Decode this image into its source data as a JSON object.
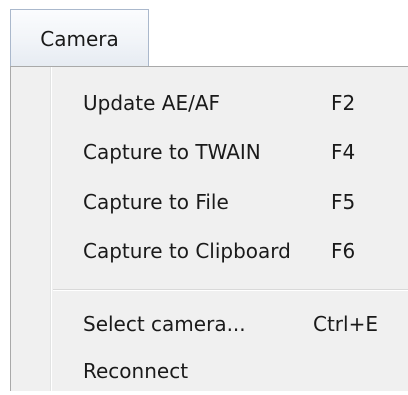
{
  "menubar": {
    "camera_label": "Camera"
  },
  "menu": {
    "items": [
      {
        "label": "Update AE/AF",
        "shortcut": "F2"
      },
      {
        "label": "Capture to TWAIN",
        "shortcut": "F4"
      },
      {
        "label": "Capture to File",
        "shortcut": "F5"
      },
      {
        "label": "Capture to Clipboard",
        "shortcut": "F6"
      },
      {
        "label": "Select camera...",
        "shortcut": "Ctrl+E"
      },
      {
        "label": "Reconnect",
        "shortcut": ""
      }
    ]
  }
}
